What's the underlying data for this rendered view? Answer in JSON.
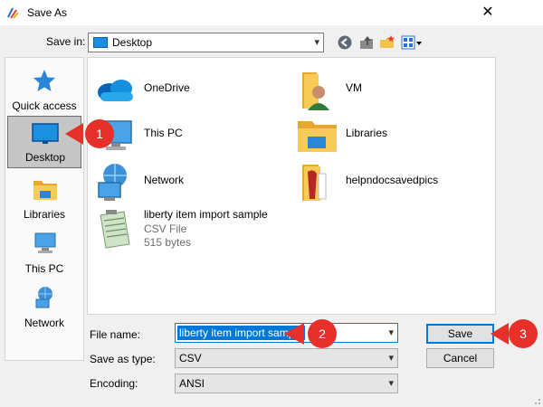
{
  "window": {
    "title": "Save As"
  },
  "toolbar": {
    "save_in_label": "Save in:",
    "save_in_value": "Desktop",
    "tools": [
      "back-icon",
      "up-folder-icon",
      "new-folder-icon",
      "view-menu-icon"
    ]
  },
  "places": [
    {
      "label": "Quick access",
      "icon": "star-icon",
      "selected": false
    },
    {
      "label": "Desktop",
      "icon": "desktop-icon",
      "selected": true
    },
    {
      "label": "Libraries",
      "icon": "libraries-icon",
      "selected": false
    },
    {
      "label": "This PC",
      "icon": "computer-icon",
      "selected": false
    },
    {
      "label": "Network",
      "icon": "network-icon",
      "selected": false
    }
  ],
  "files": [
    {
      "name": "OneDrive",
      "icon": "onedrive-icon"
    },
    {
      "name": "VM",
      "icon": "user-folder-icon"
    },
    {
      "name": "This PC",
      "icon": "computer-icon"
    },
    {
      "name": "Libraries",
      "icon": "libraries-icon"
    },
    {
      "name": "Network",
      "icon": "network-icon"
    },
    {
      "name": "helpndocsavedpics",
      "icon": "folder-icon"
    },
    {
      "name": "liberty item import sample",
      "type": "CSV File",
      "size": "515 bytes",
      "icon": "csv-file-icon"
    }
  ],
  "form": {
    "file_name_label": "File name:",
    "file_name_value": "liberty item import sample",
    "save_as_type_label": "Save as type:",
    "save_as_type_value": "CSV",
    "encoding_label": "Encoding:",
    "encoding_value": "ANSI"
  },
  "buttons": {
    "save": "Save",
    "cancel": "Cancel"
  },
  "callouts": [
    "1",
    "2",
    "3"
  ],
  "colors": {
    "accent": "#0078d7",
    "callout": "#e8302a",
    "selected_place": "#c6c6c6"
  }
}
